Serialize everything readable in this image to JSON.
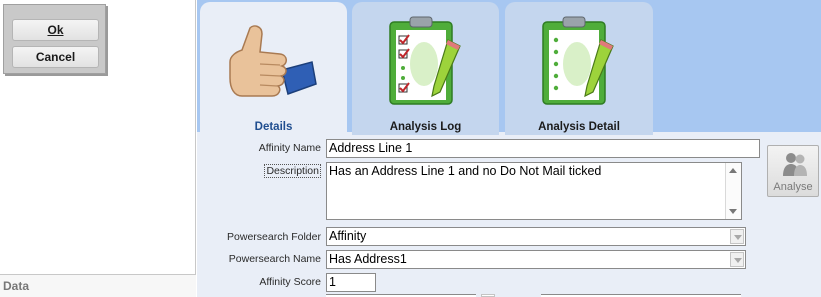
{
  "buttons": {
    "ok": "Ok",
    "cancel": "Cancel"
  },
  "left_panel": {
    "footer_label": "Data"
  },
  "tabs": [
    {
      "label": "Details",
      "icon": "thumbs-up-icon",
      "active": true
    },
    {
      "label": "Analysis Log",
      "icon": "clipboard-checklist-icon",
      "active": false
    },
    {
      "label": "Analysis Detail",
      "icon": "clipboard-pencil-icon",
      "active": false
    }
  ],
  "form": {
    "affinity_name": {
      "label": "Affinity Name",
      "value": "Address Line 1"
    },
    "description": {
      "label": "Description",
      "value": "Has an Address Line 1 and no Do Not Mail ticked"
    },
    "powersearch_folder": {
      "label": "Powersearch Folder",
      "value": "Affinity"
    },
    "powersearch_name": {
      "label": "Powersearch Name",
      "value": "Has Address1"
    },
    "affinity_score": {
      "label": "Affinity Score",
      "value": "1"
    }
  },
  "analyse": {
    "label": "Analyse",
    "icon": "people-icon"
  },
  "colors": {
    "tab_strip": "#a7c7f1",
    "active_tab": "#e9eef7",
    "inactive_tab": "#c4d6ee",
    "active_tab_text": "#1f4d8f"
  }
}
